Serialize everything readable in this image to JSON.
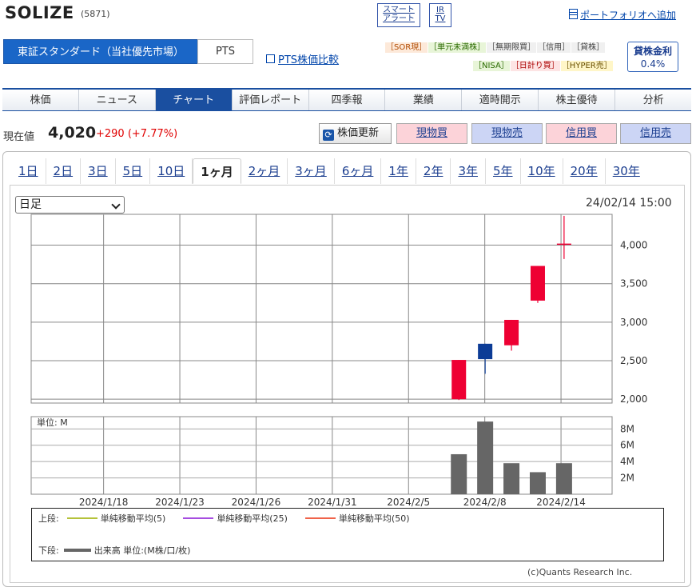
{
  "header": {
    "title": "SOLIZE",
    "code": "(5871)",
    "smart_alert": [
      "スマート",
      "アラート"
    ],
    "ir_tv": [
      "IR",
      "TV"
    ],
    "portfolio_link": "ポートフォリオへ追加"
  },
  "market": {
    "tabs": [
      "東証スタンダード（当社優先市場）",
      "PTS"
    ],
    "pts_compare": "PTS株価比較",
    "badges_row1": [
      "［SOR現］",
      "［単元未満株］",
      "［無期限買］",
      "［信用］",
      "［貸株］"
    ],
    "badges_row2": [
      "［NISA］",
      "［日計り買］",
      "［HYPER売］"
    ],
    "lending_rate_label": "貸株金利",
    "lending_rate_value": "0.4%"
  },
  "nav": {
    "items": [
      "株価",
      "ニュース",
      "チャート",
      "評価レポート",
      "四季報",
      "業績",
      "適時開示",
      "株主優待",
      "分析"
    ],
    "active": "チャート"
  },
  "price": {
    "label": "現在値",
    "value": "4,020",
    "change": "+290 (+7.77%)",
    "refresh": "株価更新",
    "buttons": [
      "現物買",
      "現物売",
      "信用買",
      "信用売"
    ]
  },
  "chart_controls": {
    "periods": [
      "1日",
      "2日",
      "3日",
      "5日",
      "10日",
      "1ヶ月",
      "2ヶ月",
      "3ヶ月",
      "6ヶ月",
      "1年",
      "2年",
      "3年",
      "5年",
      "10年",
      "20年",
      "30年"
    ],
    "active_period": "1ヶ月",
    "interval": "日足",
    "timestamp": "24/02/14 15:00"
  },
  "chart_data": {
    "type": "candlestick",
    "x_labels": [
      "2024/1/18",
      "2024/1/23",
      "2024/1/26",
      "2024/1/31",
      "2024/2/5",
      "2024/2/8",
      "2024/2/14"
    ],
    "price_axis": {
      "ticks": [
        "4,000",
        "3,500",
        "3,000",
        "2,500",
        "2,000"
      ],
      "ylim": [
        1950,
        4400
      ]
    },
    "volume_axis": {
      "ticks": [
        "8M",
        "6M",
        "4M",
        "2M"
      ],
      "unit_label": "単位: M",
      "ylim": [
        0,
        9.5
      ]
    },
    "candles": [
      {
        "date": "2024-02-07",
        "open": 2000,
        "close": 2510,
        "high": 2510,
        "low": 1990,
        "color": "#ee0033"
      },
      {
        "date": "2024-02-08",
        "open": 2720,
        "close": 2520,
        "high": 2720,
        "low": 2330,
        "color": "#0c3c96"
      },
      {
        "date": "2024-02-09",
        "open": 2700,
        "close": 3030,
        "high": 3030,
        "low": 2630,
        "color": "#ee0033"
      },
      {
        "date": "2024-02-13",
        "open": 3280,
        "close": 3730,
        "high": 3730,
        "low": 3250,
        "color": "#ee0033"
      },
      {
        "date": "2024-02-14",
        "open": 4010,
        "close": 4020,
        "high": 4380,
        "low": 3820,
        "color": "#ee0033"
      }
    ],
    "volume": [
      {
        "date": "2024-02-07",
        "value": 4.9
      },
      {
        "date": "2024-02-08",
        "value": 8.9
      },
      {
        "date": "2024-02-09",
        "value": 3.8
      },
      {
        "date": "2024-02-13",
        "value": 2.7
      },
      {
        "date": "2024-02-14",
        "value": 3.8
      }
    ],
    "legend": {
      "upper_label": "上段:",
      "lower_label": "下段:",
      "ma": [
        {
          "name": "単純移動平均(5)",
          "color": "#b5c23a"
        },
        {
          "name": "単純移動平均(25)",
          "color": "#a64de0"
        },
        {
          "name": "単純移動平均(50)",
          "color": "#f0634a"
        }
      ],
      "volume_name": "出来高 単位:(M株/口/枚)"
    }
  },
  "copyright": "(c)Quants Research Inc."
}
